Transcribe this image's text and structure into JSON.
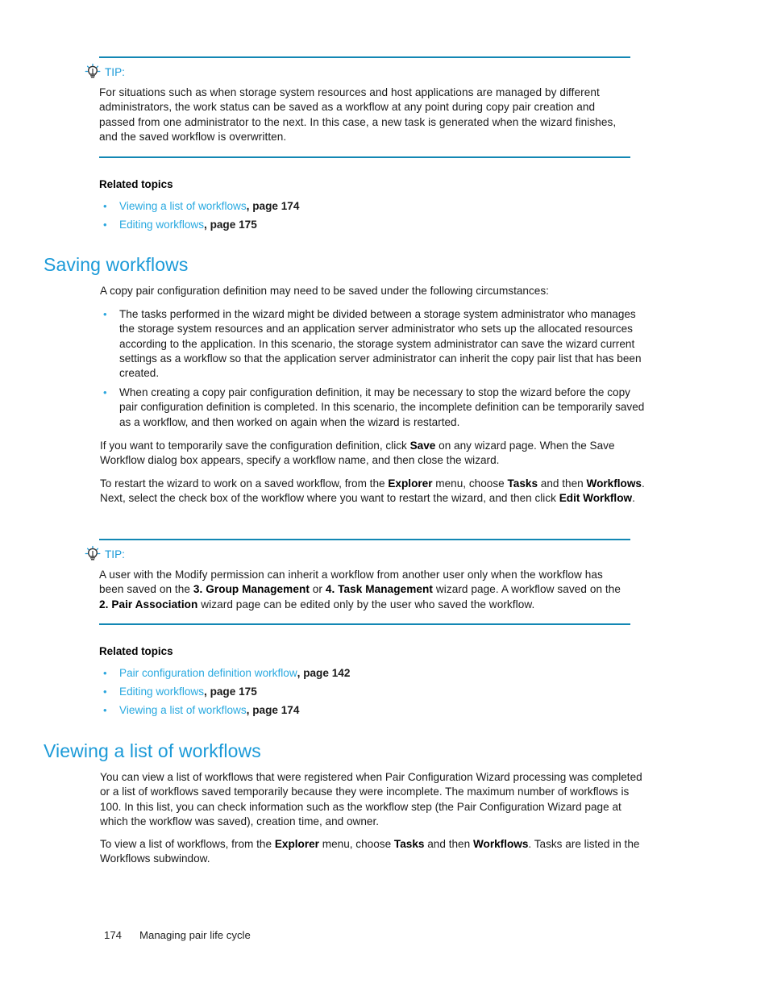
{
  "document": {
    "page_number": "174",
    "footer_title": "Managing pair life cycle",
    "accent_color": "#29a9e0",
    "rule_color": "#1287b4",
    "heading_color": "#1b9ad8"
  },
  "tip1": {
    "icon": "lightbulb-icon",
    "label": "TIP:",
    "body_html": "For situations such as when storage system resources and host applications are managed by different administrators, the work status can be saved as a workflow at any point during copy pair creation and passed from one administrator to the next. In this case, a new task is generated when the wizard finishes, and the saved workflow is overwritten."
  },
  "related_topics_1": {
    "title": "Related topics",
    "items": [
      {
        "link": "Viewing a list of workflows",
        "page": ", page 174"
      },
      {
        "link": "Editing workflows",
        "page": ", page 175"
      }
    ]
  },
  "section_saving": {
    "heading": "Saving workflows",
    "intro": "A copy pair configuration definition may need to be saved under the following circumstances:",
    "bullets": [
      "The tasks performed in the wizard might be divided between a storage system administrator who manages the storage system resources and an application server administrator who sets up the allocated resources according to the application. In this scenario, the storage system administrator can save the wizard current settings as a workflow so that the application server administrator can inherit the copy pair list that has been created.",
      "When creating a copy pair configuration definition, it may be necessary to stop the wizard before the copy pair configuration definition is completed. In this scenario, the incomplete definition can be temporarily saved as a workflow, and then worked on again when the wizard is restarted."
    ],
    "paragraph_2_html": "If you want to temporarily save the configuration definition, click <b>Save</b> on any wizard page. When the Save Workflow dialog box appears, specify a workflow name, and then close the wizard.",
    "paragraph_3_html": "To restart the wizard to work on a saved workflow, from the <b>Explorer</b> menu, choose <b>Tasks</b> and then <b>Workflows</b>. Next, select the check box of the workflow where you want to restart the wizard, and then click <b>Edit Workflow</b>."
  },
  "tip2": {
    "icon": "lightbulb-icon",
    "label": "TIP:",
    "body_html": "A user with the Modify permission can inherit a workflow from another user only when the workflow has been saved on the <b>3. Group Management</b> or <b>4. Task Management</b> wizard page. A workflow saved on the <b>2. Pair Association</b> wizard page can be edited only by the user who saved the workflow."
  },
  "related_topics_2": {
    "title": "Related topics",
    "items": [
      {
        "link": "Pair configuration definition workflow",
        "page": ", page 142"
      },
      {
        "link": "Editing workflows",
        "page": ", page 175"
      },
      {
        "link": "Viewing a list of workflows",
        "page": ", page 174"
      }
    ]
  },
  "section_viewing": {
    "heading": "Viewing a list of workflows",
    "paragraph_1": "You can view a list of workflows that were registered when Pair Configuration Wizard processing was completed or a list of workflows saved temporarily because they were incomplete. The maximum number of workflows is 100. In this list, you can check information such as the workflow step (the Pair Configuration Wizard page at which the workflow was saved), creation time, and owner.",
    "paragraph_2_html": "To view a list of workflows, from the <b>Explorer</b> menu, choose <b>Tasks</b> and then <b>Workflows</b>. Tasks are listed in the Workflows subwindow."
  }
}
